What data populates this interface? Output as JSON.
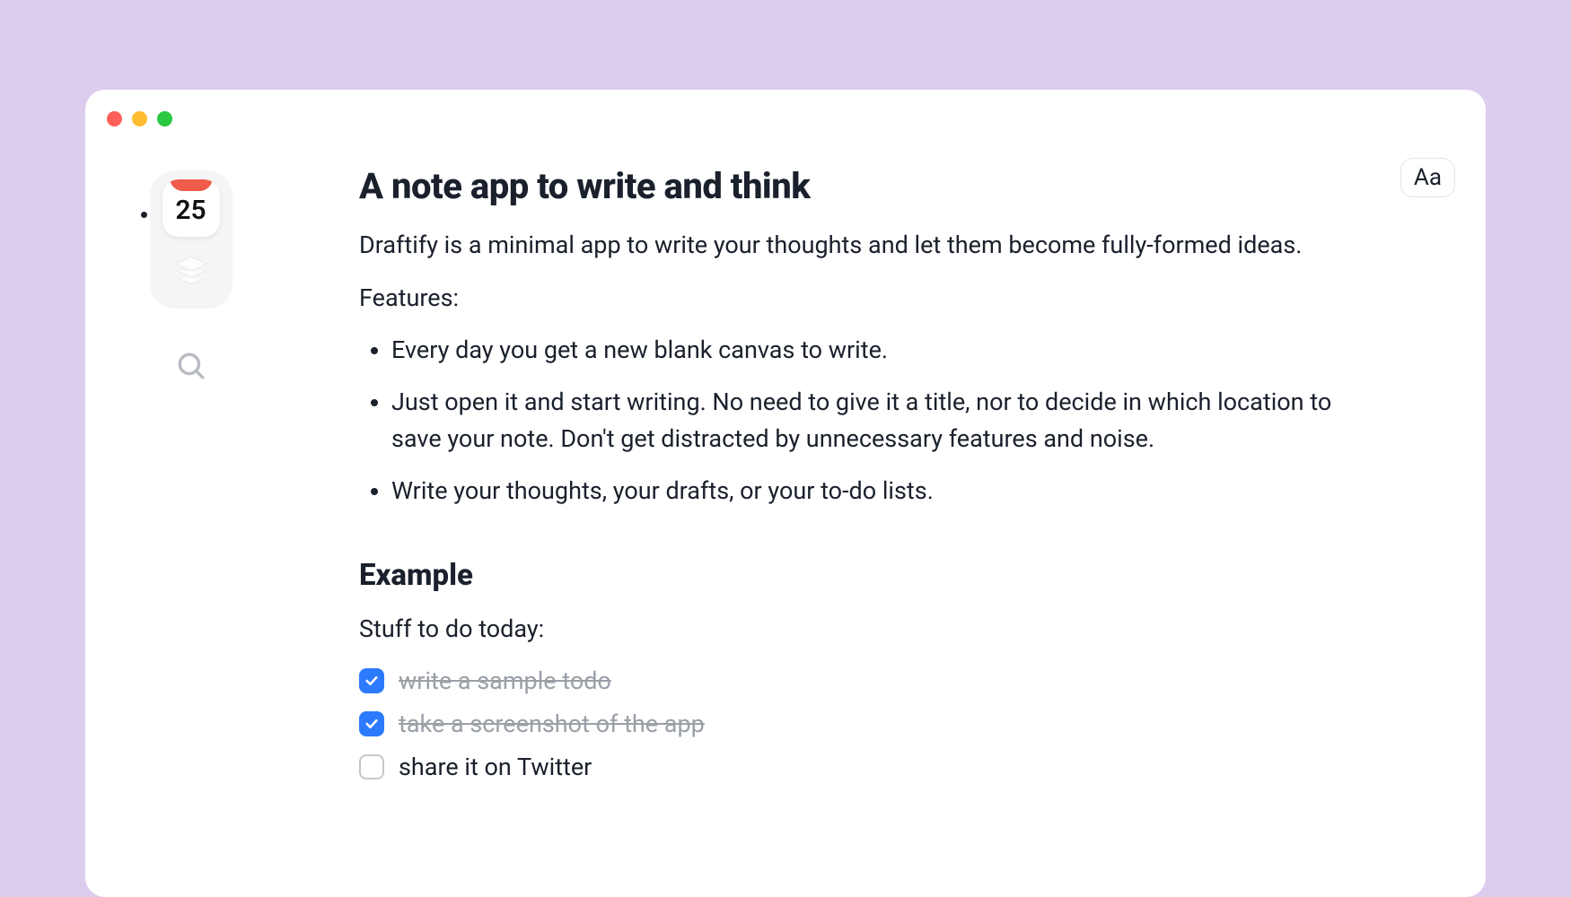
{
  "sidebar": {
    "calendar_day": "25"
  },
  "topbar": {
    "typography_button": "Aa"
  },
  "note": {
    "title": "A note app to write and think",
    "intro": "Draftify is a minimal app to write your thoughts and let them become fully-formed ideas.",
    "features_label": "Features:",
    "features": [
      "Every day you get a new blank canvas to write.",
      "Just open it and start writing. No need to give it a title, nor to decide in which location to save your note. Don't get distracted by unnecessary features and noise.",
      "Write your thoughts, your drafts, or your to-do lists."
    ],
    "example_heading": "Example",
    "example_intro": "Stuff to do today:",
    "todos": [
      {
        "text": "write a sample todo",
        "done": true
      },
      {
        "text": "take a screenshot of the app",
        "done": true
      },
      {
        "text": "share it on Twitter",
        "done": false
      }
    ]
  }
}
